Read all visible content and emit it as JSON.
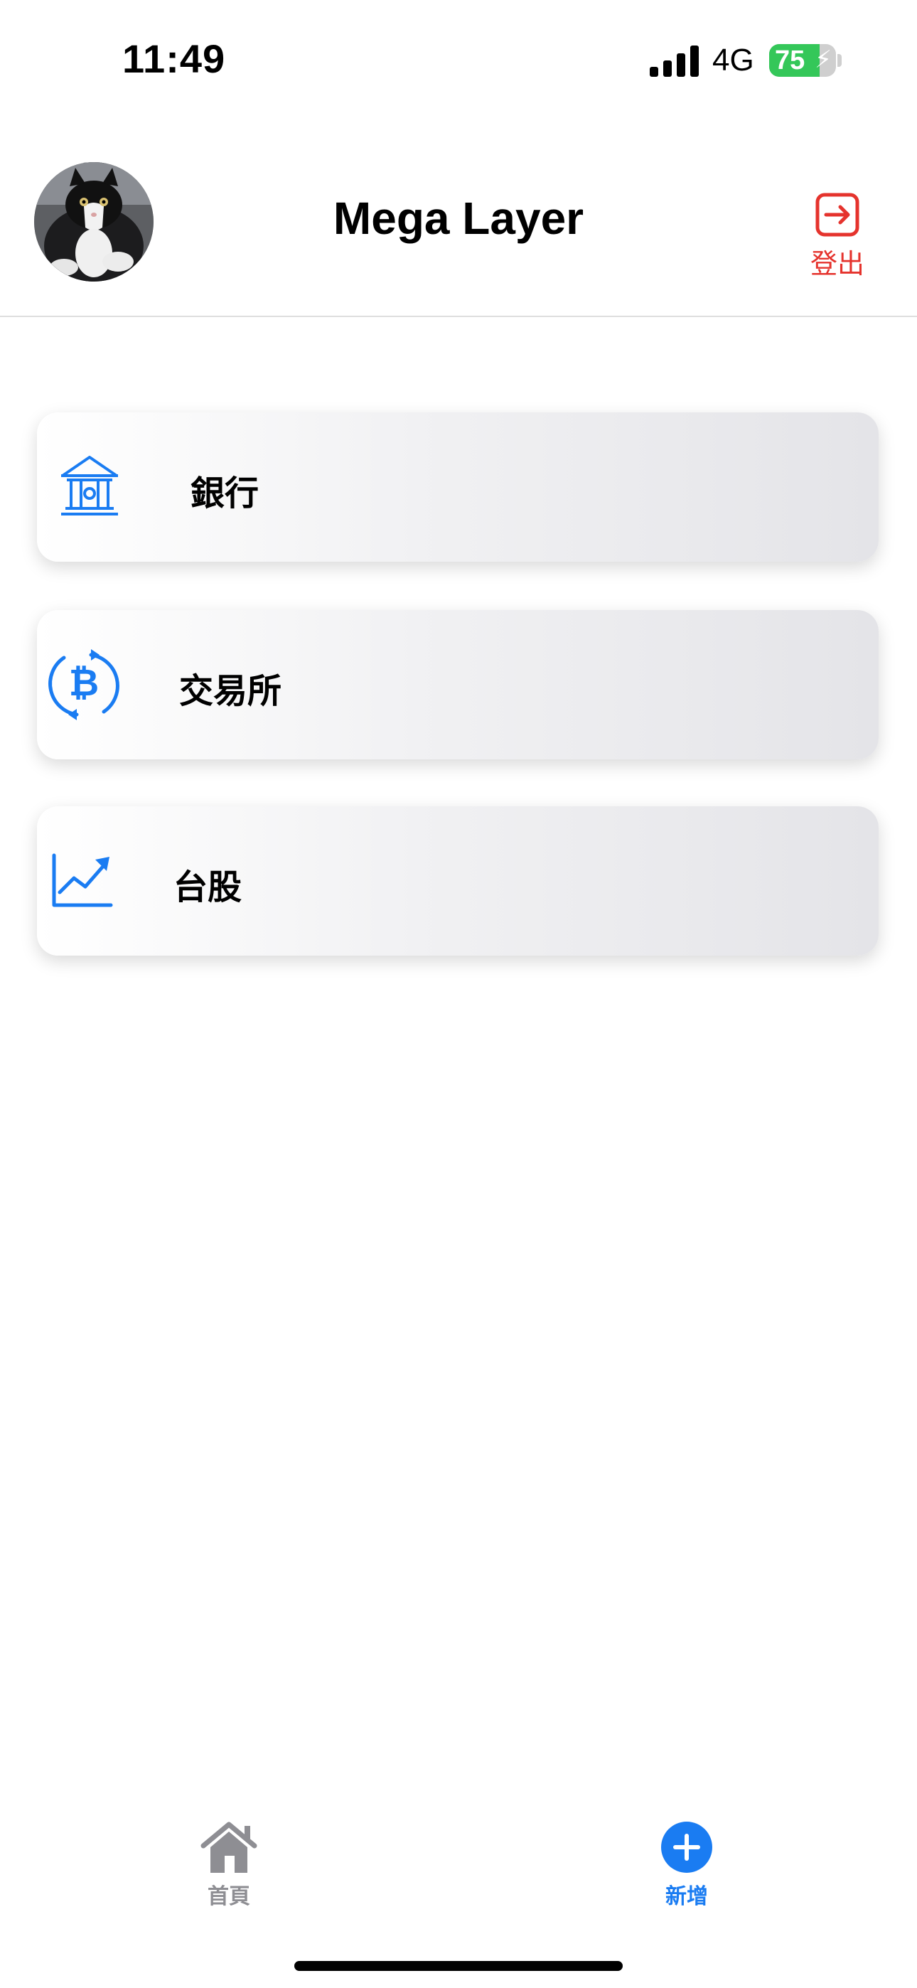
{
  "status_bar": {
    "time": "11:49",
    "network": "4G",
    "battery_level": "75",
    "battery_fraction": 0.75,
    "signal_icon": "cellular-signal-icon",
    "battery_icon": "battery-charging-icon"
  },
  "header": {
    "title": "Mega Layer",
    "avatar": "profile-avatar-cat",
    "logout_label": "登出",
    "logout_icon": "logout-arrow-icon"
  },
  "categories": [
    {
      "label": "銀行",
      "icon": "bank-icon"
    },
    {
      "label": "交易所",
      "icon": "bitcoin-exchange-icon"
    },
    {
      "label": "台股",
      "icon": "stock-chart-icon"
    }
  ],
  "tab_bar": {
    "tabs": [
      {
        "label": "首頁",
        "icon": "home-icon",
        "active": false
      },
      {
        "label": "新增",
        "icon": "plus-circle-icon",
        "active": true
      }
    ]
  },
  "colors": {
    "accent_blue": "#1a7cf2",
    "logout_red": "#e5332d",
    "inactive_gray": "#8e8e93",
    "battery_green": "#34c759"
  }
}
